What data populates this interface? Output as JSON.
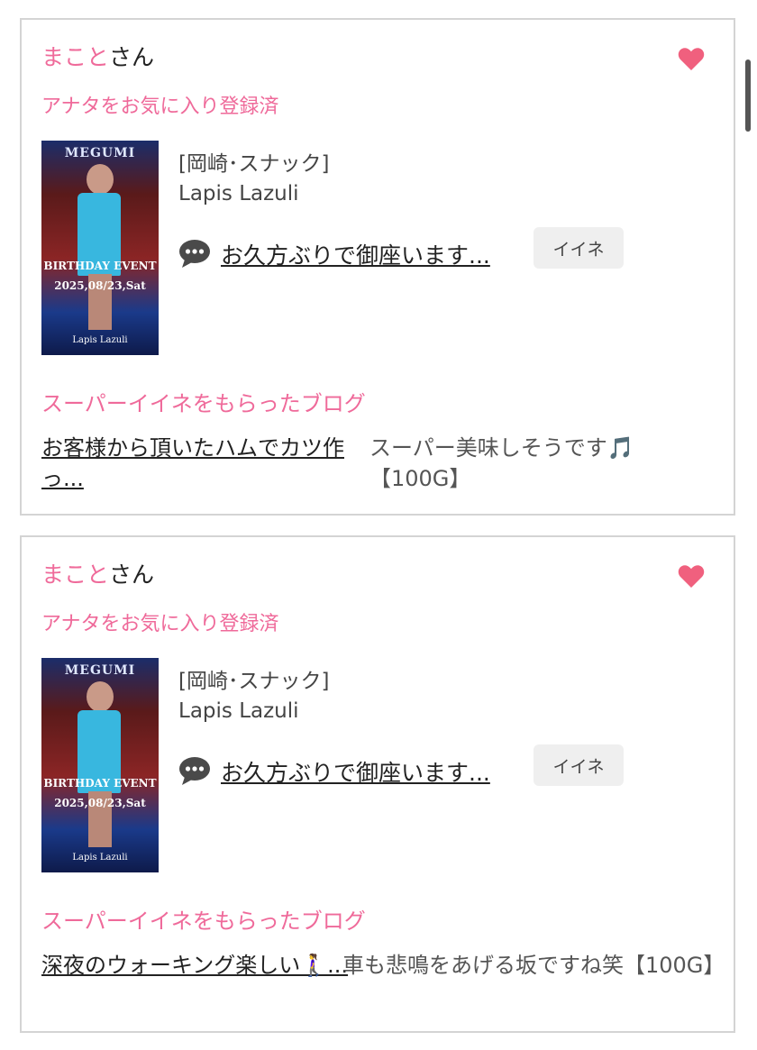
{
  "colors": {
    "accent": "#ef6a9a",
    "heart": "#f0607e",
    "card_border": "#d4d4d4"
  },
  "icons": {
    "favorite": "heart-icon",
    "comment": "speech-bubble-icon"
  },
  "cards": [
    {
      "user_name": "まこと",
      "honorific": "さん",
      "favorite_status": "アナタをお気に入り登録済",
      "shop_category": "[岡崎･スナック]",
      "shop_name": "Lapis Lazuli",
      "post_title": "お久方ぶりで御座います...",
      "like_button": "イイネ",
      "thumbnail_text": [
        "MEGUMI",
        "BIRTHDAY EVENT",
        "2025,08/23,Sat",
        "Lapis Lazuli"
      ],
      "super_like_heading": "スーパーイイネをもらったブログ",
      "super_blog_title": "お客様から頂いたハムでカツ作っ...",
      "super_comment": "スーパー美味しそうです🎵【100G】"
    },
    {
      "user_name": "まこと",
      "honorific": "さん",
      "favorite_status": "アナタをお気に入り登録済",
      "shop_category": "[岡崎･スナック]",
      "shop_name": "Lapis Lazuli",
      "post_title": "お久方ぶりで御座います...",
      "like_button": "イイネ",
      "thumbnail_text": [
        "MEGUMI",
        "BIRTHDAY EVENT",
        "2025,08/23,Sat",
        "Lapis Lazuli"
      ],
      "super_like_heading": "スーパーイイネをもらったブログ",
      "super_blog_title": "深夜のウォーキング楽しい🚶‍♀️...",
      "super_comment": "車も悲鳴をあげる坂ですね笑【100G】"
    }
  ]
}
